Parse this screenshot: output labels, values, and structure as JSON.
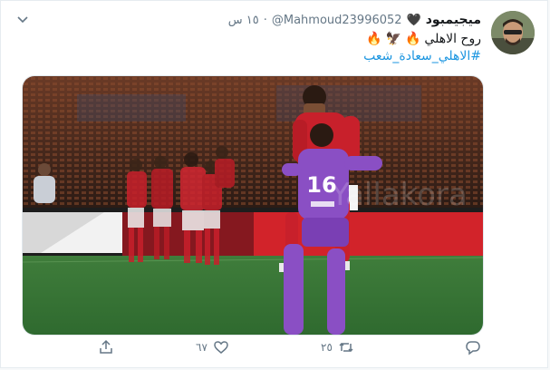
{
  "tweet": {
    "display_name": "ميجيمبود",
    "handle": "@Mahmoud23996052",
    "separator": "·",
    "time": "١٥ س",
    "text": "روح الاهلي",
    "hashtag": "#الاهلي_سعادة_شعب",
    "emojis": [
      "🔥",
      "🦅",
      "🔥"
    ]
  },
  "media": {
    "jersey_number": "16",
    "watermark": "Yallakora"
  },
  "actions": {
    "like_count": "٦٧",
    "retweet_count": "٢٥",
    "icons": [
      "share-icon",
      "like-icon",
      "retweet-icon",
      "reply-icon"
    ]
  },
  "colors": {
    "link": "#1b95e0",
    "muted": "#657786",
    "pitch": "#3f7d3b",
    "kit_red": "#c8202b",
    "keeper_purple": "#8a4fc4"
  }
}
